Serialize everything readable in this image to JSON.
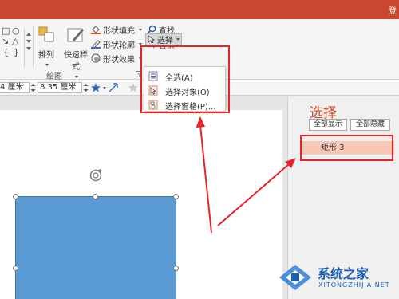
{
  "titlebar": {
    "login_fragment": "登"
  },
  "ribbon": {
    "shape_gallery_glyphs": [
      "□",
      "○",
      "↘",
      "△",
      "{",
      "}",
      "☆",
      "↓",
      "↩"
    ],
    "arrange_label": "排列",
    "quickstyle_label": "快速样式",
    "shape_fill_label": "形状填充",
    "shape_outline_label": "形状轮廓",
    "shape_effect_label": "形状效果",
    "find_label": "查找",
    "replace_label": "替换",
    "select_label": "选择",
    "drawing_group_label": "绘图"
  },
  "formatbar": {
    "width_value": "4 厘米",
    "height_value": "8.35 厘米"
  },
  "select_menu": {
    "items": [
      {
        "label": "全选(A)",
        "icon": "select-all-icon"
      },
      {
        "label": "选择对象(O)",
        "icon": "select-object-icon"
      },
      {
        "label": "选择窗格(P)...",
        "icon": "selection-pane-icon"
      }
    ]
  },
  "selection_pane": {
    "title": "选择",
    "show_all_label": "全部显示",
    "hide_all_label": "全部隐藏",
    "items": [
      "矩形 3"
    ]
  },
  "watermark": {
    "name": "系统之家",
    "domain": "XITONGZHIJIA.NET"
  },
  "colors": {
    "titlebar": "#c8472e",
    "pane_title": "#d24726",
    "highlight": "#f7c7b5",
    "annotation_red": "#e8242a",
    "shape_fill": "#5b9bd5"
  }
}
